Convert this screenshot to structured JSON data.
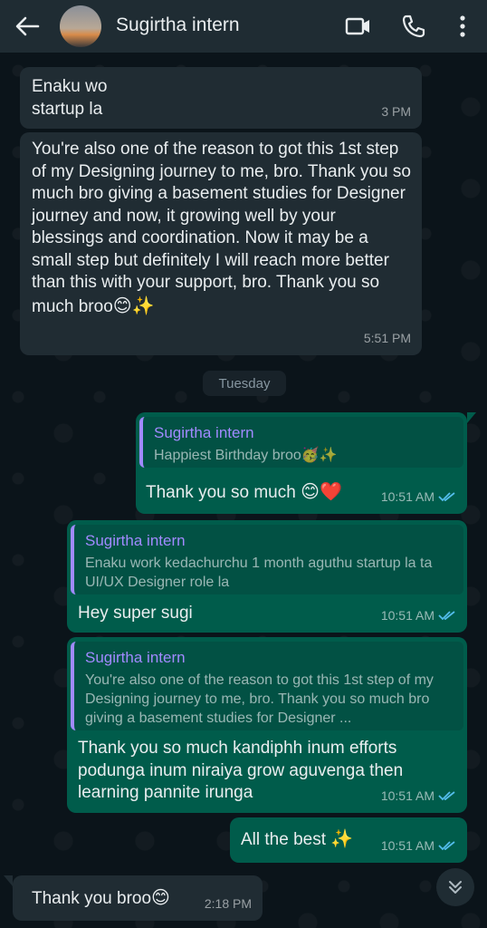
{
  "header": {
    "contact_name": "Sugirtha intern",
    "icons": [
      "back-arrow-icon",
      "video-call-icon",
      "voice-call-icon",
      "more-options-icon"
    ]
  },
  "colors": {
    "header_bg": "#1f2c33",
    "incoming_bubble": "#202c33",
    "outgoing_bubble": "#005c4b",
    "quote_accent": "#a18aff",
    "read_ticks": "#53bdeb"
  },
  "messages": [
    {
      "direction": "incoming",
      "text_line1": "Enaku wo",
      "text_line2": "startup la",
      "time": "3 PM"
    },
    {
      "direction": "incoming",
      "text": "You're also one of the reason to got this 1st step of my Designing journey to me, bro. Thank you so much bro giving a basement studies for Designer journey and now, it growing well by your blessings and coordination. Now it may be a small step but definitely I will reach more better than this with your support, bro. Thank you so much broo",
      "emoji": "😊✨",
      "time": "5:51 PM"
    }
  ],
  "day_separator": "Tuesday",
  "outgoing": [
    {
      "quote_name": "Sugirtha intern",
      "quote_text": "Happiest Birthday broo🥳✨",
      "text": "Thank you so much ",
      "emoji": "😊❤️",
      "time": "10:51 AM"
    },
    {
      "quote_name": "Sugirtha intern",
      "quote_text": "Enaku work kedachurchu 1 month aguthu startup la ta UI/UX Designer role la",
      "text": "Hey super sugi",
      "time": "10:51 AM"
    },
    {
      "quote_name": "Sugirtha intern",
      "quote_text": "You're also one of the reason to got this 1st step of my Designing journey to me, bro. Thank you so much bro giving a basement studies for Designer ...",
      "text": "Thank you so much kandiphh inum efforts podunga inum niraiya grow aguvenga then learning pannite irunga",
      "time": "10:51 AM"
    },
    {
      "text": "All the best ",
      "emoji": "✨",
      "time": "10:51 AM"
    }
  ],
  "last_incoming": {
    "text": "Thank you broo",
    "emoji": "😊",
    "time": "2:18 PM"
  },
  "scroll_button_icon": "double-chevron-down-icon"
}
